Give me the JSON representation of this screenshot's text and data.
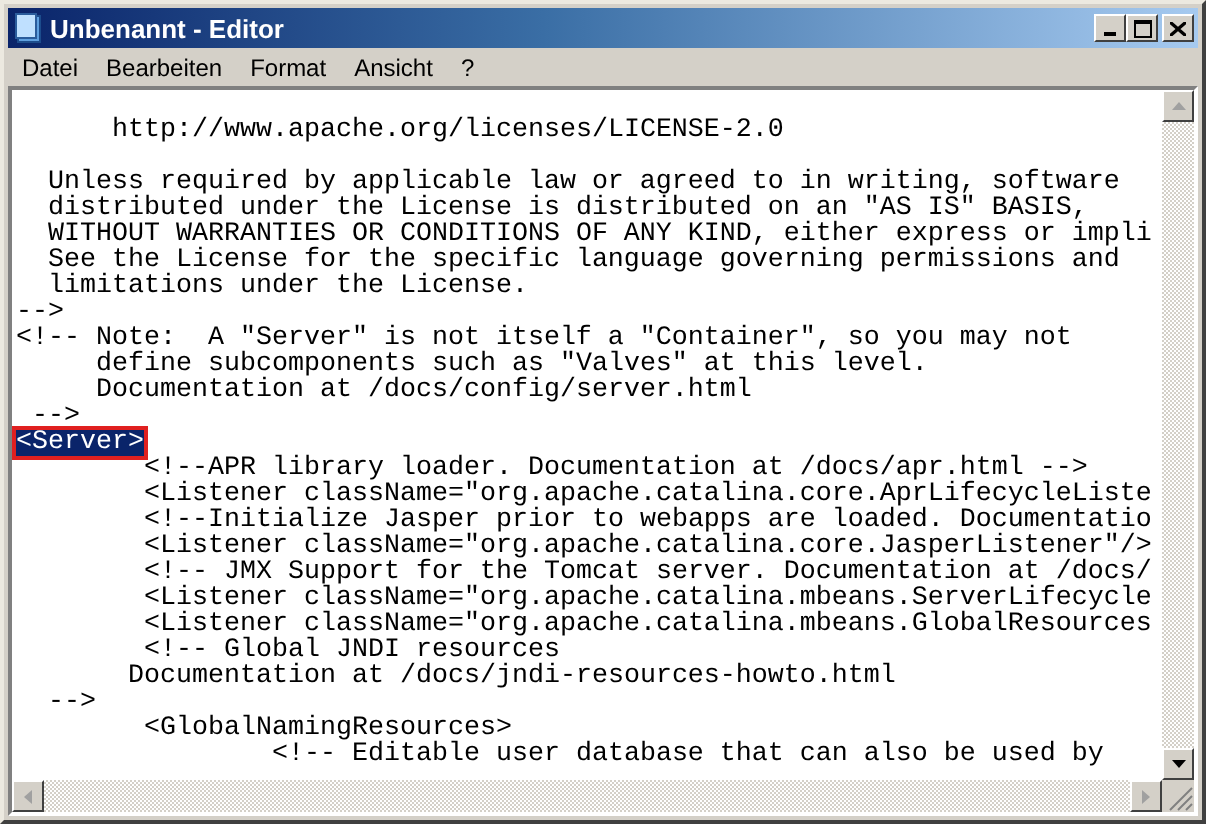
{
  "window": {
    "title": "Unbenannt - Editor"
  },
  "menu": [
    {
      "label": "Datei"
    },
    {
      "label": "Bearbeiten"
    },
    {
      "label": "Format"
    },
    {
      "label": "Ansicht"
    },
    {
      "label": "?"
    }
  ],
  "editor": {
    "lines": [
      {
        "text": "      http://www.apache.org/licenses/LICENSE-2.0",
        "gap_before": true,
        "selected": false,
        "marked": false
      },
      {
        "text": "  Unless required by applicable law or agreed to in writing, software",
        "gap_before": true,
        "selected": false,
        "marked": false
      },
      {
        "text": "  distributed under the License is distributed on an \"AS IS\" BASIS,",
        "selected": false,
        "marked": false
      },
      {
        "text": "  WITHOUT WARRANTIES OR CONDITIONS OF ANY KIND, either express or impli",
        "selected": false,
        "marked": false
      },
      {
        "text": "  See the License for the specific language governing permissions and",
        "selected": false,
        "marked": false
      },
      {
        "text": "  limitations under the License.",
        "selected": false,
        "marked": false
      },
      {
        "text": "-->",
        "selected": false,
        "marked": false
      },
      {
        "text": "<!-- Note:  A \"Server\" is not itself a \"Container\", so you may not",
        "selected": false,
        "marked": false
      },
      {
        "text": "     define subcomponents such as \"Valves\" at this level.",
        "selected": false,
        "marked": false
      },
      {
        "text": "     Documentation at /docs/config/server.html",
        "selected": false,
        "marked": false
      },
      {
        "text": " -->",
        "selected": false,
        "marked": false
      },
      {
        "text": "<Server>",
        "selected": true,
        "marked": true
      },
      {
        "text": "        <!--APR library loader. Documentation at /docs/apr.html -->",
        "selected": false,
        "marked": false
      },
      {
        "text": "        <Listener className=\"org.apache.catalina.core.AprLifecycleListe",
        "selected": false,
        "marked": false
      },
      {
        "text": "        <!--Initialize Jasper prior to webapps are loaded. Documentatio",
        "selected": false,
        "marked": false
      },
      {
        "text": "        <Listener className=\"org.apache.catalina.core.JasperListener\"/>",
        "selected": false,
        "marked": false
      },
      {
        "text": "        <!-- JMX Support for the Tomcat server. Documentation at /docs/",
        "selected": false,
        "marked": false
      },
      {
        "text": "        <Listener className=\"org.apache.catalina.mbeans.ServerLifecycle",
        "selected": false,
        "marked": false
      },
      {
        "text": "        <Listener className=\"org.apache.catalina.mbeans.GlobalResources",
        "selected": false,
        "marked": false
      },
      {
        "text": "        <!-- Global JNDI resources",
        "selected": false,
        "marked": false
      },
      {
        "text": "       Documentation at /docs/jndi-resources-howto.html",
        "selected": false,
        "marked": false
      },
      {
        "text": "  -->",
        "selected": false,
        "marked": false
      },
      {
        "text": "        <GlobalNamingResources>",
        "selected": false,
        "marked": false
      },
      {
        "text": "                <!-- Editable user database that can also be used by",
        "selected": false,
        "marked": false
      }
    ]
  }
}
